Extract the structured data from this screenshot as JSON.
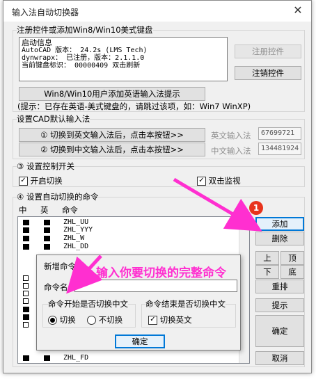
{
  "window": {
    "title": "输入法自动切换器",
    "close_glyph": "✕"
  },
  "register": {
    "group_label": "注册控件或添加Win8/Win10美式键盘",
    "info_lines": [
      "启动信息",
      "AutoCAD 版本： 24.2s (LMS Tech)",
      "dynwrapx： 已注册，版本：2.1.1.0",
      "当前键盘标识： 00000409 双击刷新"
    ],
    "register_button": "注册控件",
    "unregister_button": "注销控件",
    "add_english_button": "Win8/Win10用户添加英语输入法提示",
    "hint": "(提示：已存在英语-美式键盘的，请跳过该项，如：Win7 WinXP)"
  },
  "cad_default": {
    "group_label": "设置CAD默认输入法",
    "btn_english": "① 切换到英文输入法后，点击本按钮>>",
    "btn_chinese": "② 切换到中文输入法后，点击本按钮>>",
    "label_english": "英文输入法",
    "label_chinese": "中文输入法",
    "value_english": "67699721",
    "value_chinese": "134481924"
  },
  "control": {
    "group_label": "③ 设置控制开关",
    "enable_label": "开启切换",
    "enable_checked": true,
    "monitor_label": "双击监视",
    "monitor_checked": true
  },
  "commands": {
    "group_label": "④ 设置自动切换的命令",
    "col_cn": "中",
    "col_en": "英",
    "col_cmd": "命令",
    "rows_top": [
      {
        "cn": true,
        "en": true,
        "cmd": "ZHL_UU"
      },
      {
        "cn": true,
        "en": true,
        "cmd": "ZHL_YYY"
      },
      {
        "cn": true,
        "en": true,
        "cmd": "ZHL_W"
      },
      {
        "cn": true,
        "en": true,
        "cmd": "ZHL_DD"
      }
    ],
    "rows_left": [
      {
        "cn": false
      },
      {
        "cn": false
      },
      {
        "cn": false
      },
      {
        "cn": false
      },
      {
        "cn": true
      },
      {
        "cn": true
      },
      {
        "cn": false
      }
    ],
    "row_bottom": {
      "cn": true,
      "en": true,
      "cmd": "ZHL_FD"
    },
    "buttons": {
      "add": "添加",
      "delete": "删除",
      "up": "上",
      "top": "顶",
      "down": "下",
      "bottom": "底",
      "reorder": "重排",
      "hint": "提示",
      "ok": "确定",
      "cancel": "取消"
    }
  },
  "dialog": {
    "title": "新增命令",
    "cmd_label": "命令名",
    "cmd_value": "",
    "start_group": "命令开始是否切换中文",
    "opt_switch": "切换",
    "opt_noswitch": "不切换",
    "end_group": "命令结束是否切换中文",
    "end_check_label": "切换英文",
    "end_checked": true,
    "ok_button": "确定"
  },
  "annotation": {
    "badge": "1",
    "text": "输入你要切换的完整命令",
    "color": "#ff2fd0"
  }
}
